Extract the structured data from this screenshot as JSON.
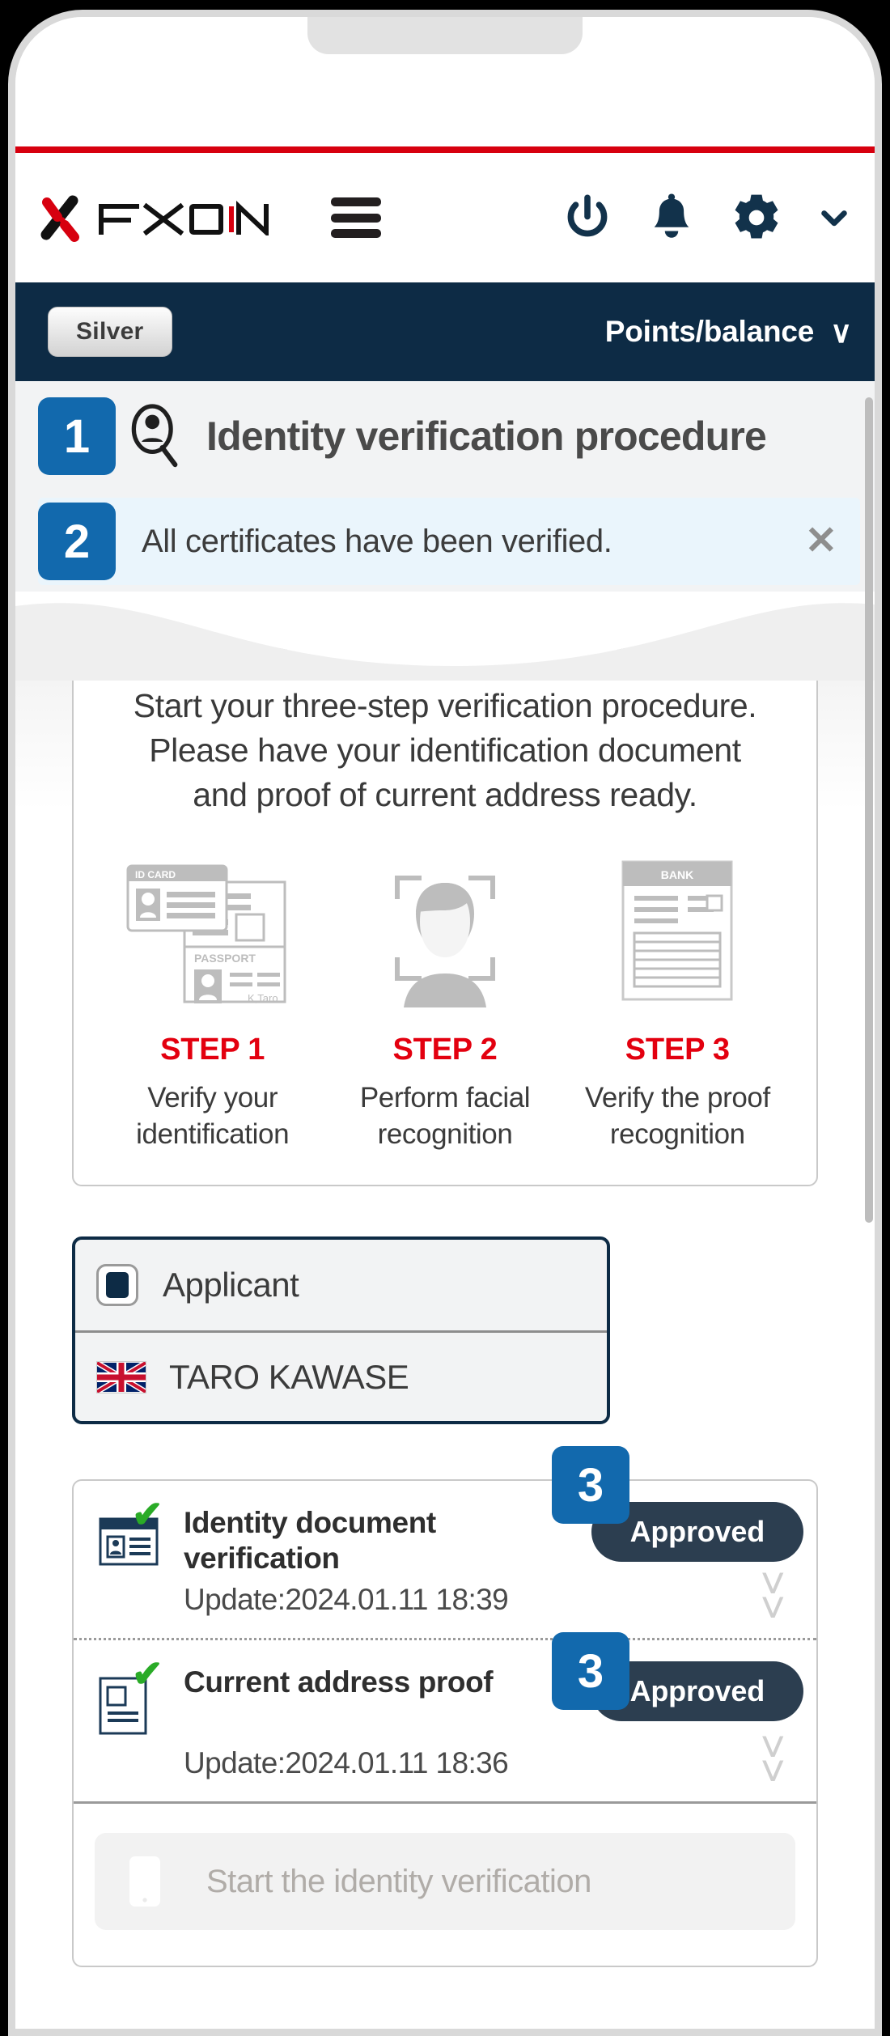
{
  "brand": {
    "name": "FXON",
    "menu_icon": "hamburger-icon",
    "icons": [
      "power-icon",
      "bell-icon",
      "gear-icon",
      "chevron-down-icon"
    ],
    "accent_red": "#d7000f"
  },
  "account_bar": {
    "tier_label": "Silver",
    "points_label": "Points/balance",
    "chevron": "∨",
    "background": "#0d2b45"
  },
  "page": {
    "badge": "1",
    "title": "Identity verification procedure",
    "title_icon": "identity-magnifier-icon"
  },
  "notice": {
    "badge": "2",
    "message": "All certificates have been verified.",
    "close_label": "✕",
    "background": "#eaf5fc"
  },
  "intro": {
    "line1": "Start your three-step verification procedure.",
    "line2": "Please have your identification document",
    "line3": "and proof of current address ready."
  },
  "steps": [
    {
      "art": "id-card-passport-icon",
      "art_labels": [
        "ID CARD",
        "PASSPORT",
        "K,Taro"
      ],
      "label": "STEP 1",
      "desc_line1": "Verify your",
      "desc_line2": "identification"
    },
    {
      "art": "face-recognition-icon",
      "art_labels": [],
      "label": "STEP 2",
      "desc_line1": "Perform facial",
      "desc_line2": "recognition"
    },
    {
      "art": "bank-statement-icon",
      "art_labels": [
        "BANK"
      ],
      "label": "STEP 3",
      "desc_line1": "Verify the proof",
      "desc_line2": "recognition"
    }
  ],
  "step_label_color": "#e3000f",
  "applicant": {
    "selector_label": "Applicant",
    "selector_icon": "filled-radio-icon",
    "flag_icon": "uk-flag-icon",
    "name": "TARO KAWASE"
  },
  "verifications": [
    {
      "icon": "id-card-icon",
      "check_icon": "green-check-icon",
      "name": "Identity document verification",
      "status": "Approved",
      "update": "Update:2024.01.11 18:39",
      "expand_icon": "double-chevron-down-icon",
      "callout": "3"
    },
    {
      "icon": "address-proof-icon",
      "check_icon": "green-check-icon",
      "name": "Current address proof",
      "status": "Approved",
      "update": "Update:2024.01.11 18:36",
      "expand_icon": "double-chevron-down-icon",
      "callout": "3"
    }
  ],
  "status_pill_color": "#2c3e50",
  "start": {
    "icon": "smartphone-icon",
    "label": "Start the identity verification",
    "disabled": true
  }
}
